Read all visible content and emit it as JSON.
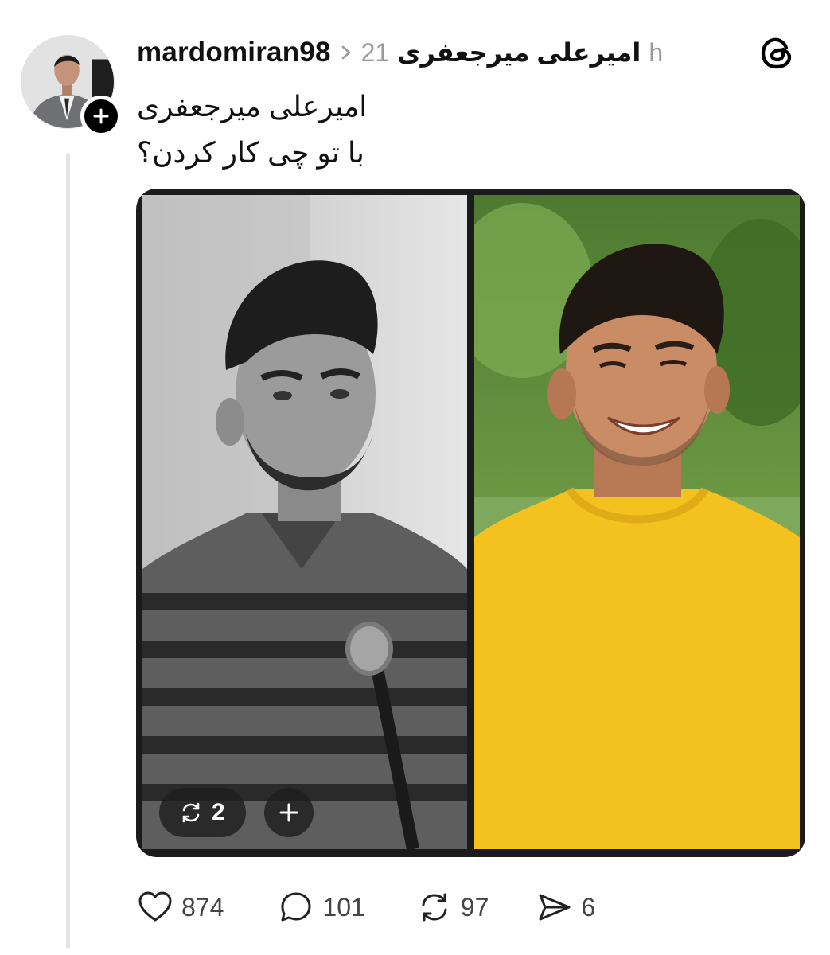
{
  "author": {
    "username": "mardomiran98",
    "avatar_icon": "profile-photo",
    "follow_icon": "plus-icon"
  },
  "topic": {
    "name": "امیرعلی میرجعفری",
    "count": "21",
    "time_suffix": "h"
  },
  "post": {
    "line1": "امیرعلی میرجعفری",
    "line2": "با تو چی کار کردن؟"
  },
  "media": {
    "repost_count": "2",
    "repost_icon": "repost-icon",
    "add_icon": "plus-icon",
    "left_photo_style": "black-and-white",
    "right_photo_style": "color",
    "shirt_color": "#f4c21f",
    "background_green": "#5a8a3a"
  },
  "actions": {
    "likes": "874",
    "replies": "101",
    "reposts": "97",
    "shares": "6"
  },
  "colors": {
    "text_primary": "#111111",
    "text_secondary": "#9a9a9a",
    "thread_line": "#e4e4e4"
  }
}
